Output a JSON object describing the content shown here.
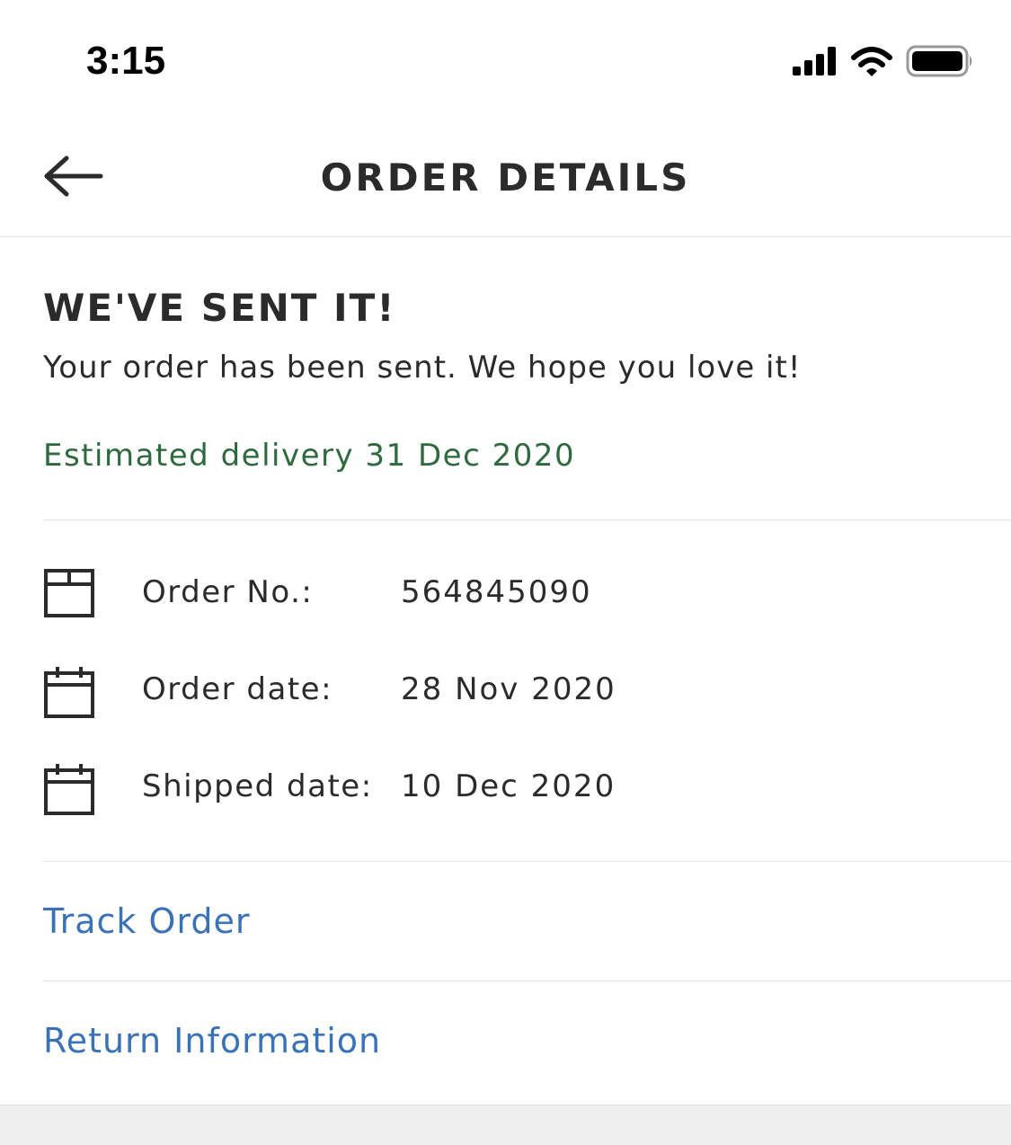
{
  "status_bar": {
    "time": "3:15",
    "icons": [
      "signal-icon",
      "wifi-icon",
      "battery-icon"
    ]
  },
  "nav": {
    "back_icon": "arrow-left-icon",
    "title": "ORDER DETAILS"
  },
  "order_status": {
    "heading": "WE'VE SENT IT!",
    "message": "Your order has been sent. We hope you love it!",
    "estimated_delivery": "Estimated delivery 31 Dec 2020"
  },
  "details": [
    {
      "icon": "box-icon",
      "label": "Order No.:",
      "value": "564845090"
    },
    {
      "icon": "calendar-icon",
      "label": "Order date:",
      "value": "28 Nov 2020"
    },
    {
      "icon": "calendar-icon",
      "label": "Shipped date:",
      "value": "10 Dec 2020"
    }
  ],
  "links": {
    "track_order": "Track Order",
    "return_information": "Return Information"
  },
  "colors": {
    "text": "#2b2b2b",
    "delivery_green": "#2e6a3e",
    "link_blue": "#3a72b8",
    "divider": "#e3e3e3",
    "footer_gray": "#efefef"
  }
}
